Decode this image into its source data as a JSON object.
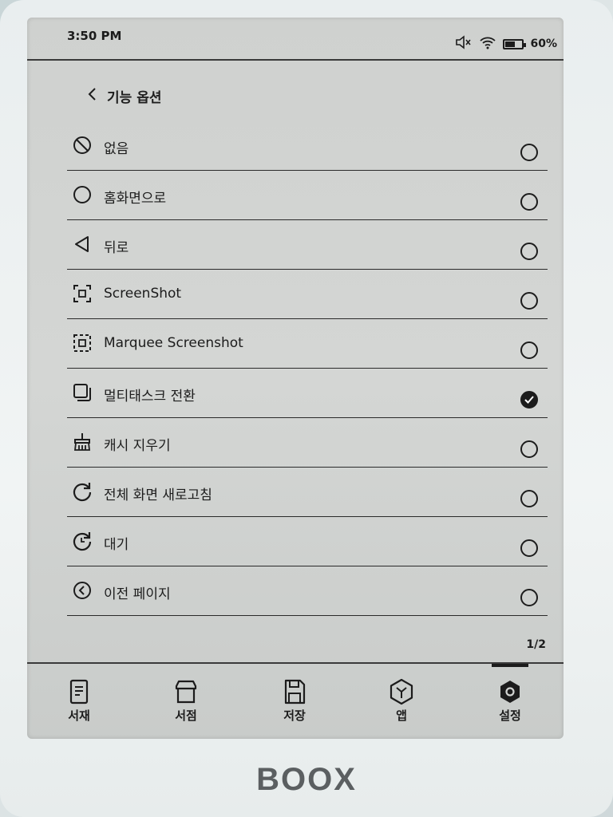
{
  "status_bar": {
    "time": "3:50 PM",
    "battery_percent": "60%",
    "battery_level": 0.6,
    "icons": [
      "mute-icon",
      "wifi-icon",
      "battery-icon"
    ]
  },
  "header": {
    "back_icon": "chevron-left-icon",
    "title": "기능 옵션"
  },
  "options": [
    {
      "label": "없음",
      "icon": "prohibit-icon",
      "selected": false
    },
    {
      "label": "홈화면으로",
      "icon": "circle-icon",
      "selected": false
    },
    {
      "label": "뒤로",
      "icon": "triangle-left-icon",
      "selected": false
    },
    {
      "label": "ScreenShot",
      "icon": "screenshot-icon",
      "selected": false
    },
    {
      "label": "Marquee Screenshot",
      "icon": "marquee-screenshot-icon",
      "selected": false
    },
    {
      "label": "멀티태스크 전환",
      "icon": "multitask-icon",
      "selected": true
    },
    {
      "label": "캐시 지우기",
      "icon": "broom-icon",
      "selected": false
    },
    {
      "label": "전체 화면 새로고침",
      "icon": "refresh-icon",
      "selected": false
    },
    {
      "label": "대기",
      "icon": "standby-icon",
      "selected": false
    },
    {
      "label": "이전 페이지",
      "icon": "previous-page-icon",
      "selected": false
    }
  ],
  "pager": "1/2",
  "bottom_nav": [
    {
      "label": "서재",
      "icon": "library-icon",
      "active": false
    },
    {
      "label": "서점",
      "icon": "store-icon",
      "active": false
    },
    {
      "label": "저장",
      "icon": "storage-icon",
      "active": false
    },
    {
      "label": "앱",
      "icon": "apps-icon",
      "active": false
    },
    {
      "label": "설정",
      "icon": "settings-icon",
      "active": true
    }
  ],
  "brand": "BOOX"
}
